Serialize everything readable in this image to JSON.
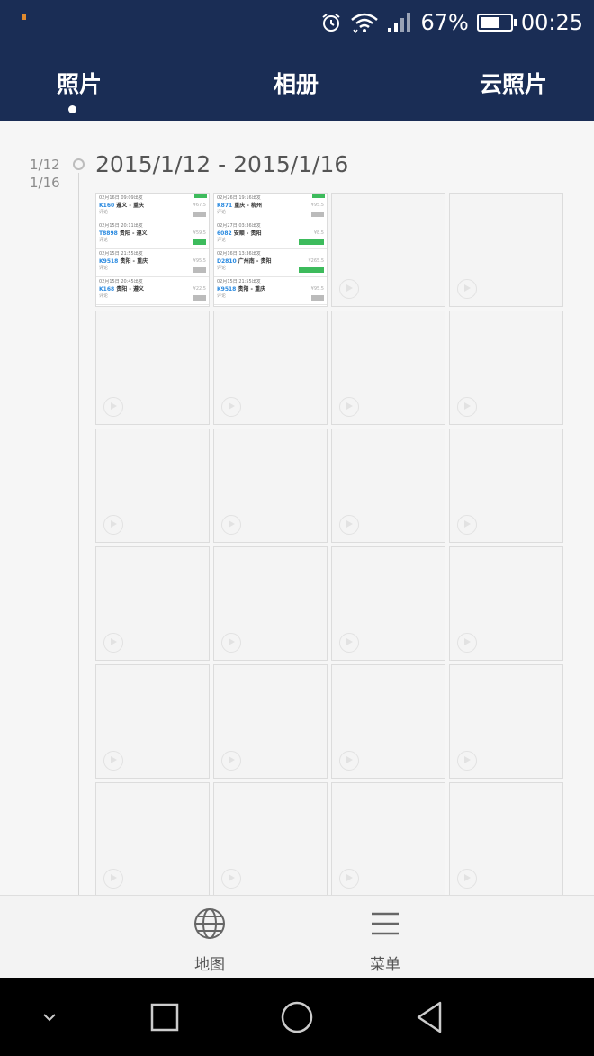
{
  "status_bar": {
    "battery_percent": "67%",
    "time": "00:25",
    "battery_level": 0.67
  },
  "tabs": [
    {
      "label": "照片",
      "selected": true
    },
    {
      "label": "相册",
      "selected": false
    },
    {
      "label": "云照片",
      "selected": false
    }
  ],
  "timeline": {
    "date_short_start": "1/12",
    "date_short_end": "1/16",
    "date_range": "2015/1/12 - 2015/1/16"
  },
  "screenshots": [
    {
      "rows": [
        {
          "time": "02月16日  09:09出发",
          "train": "K160",
          "route": "遵义 - 重庆",
          "note": "评论",
          "price": "¥67.5",
          "tag": "gray"
        },
        {
          "time": "02月15日  20:11出发",
          "train": "T8898",
          "route": "贵阳 - 遵义",
          "note": "评论",
          "price": "¥59.5",
          "tag": "green"
        },
        {
          "time": "02月15日  21:55出发",
          "train": "K9518",
          "route": "贵阳 - 重庆",
          "note": "评论",
          "price": "¥95.5",
          "tag": "gray"
        },
        {
          "time": "02月15日  20:45出发",
          "train": "K168",
          "route": "贵阳 - 遵义",
          "note": "评论",
          "price": "¥22.5",
          "tag": "gray"
        }
      ]
    },
    {
      "rows": [
        {
          "time": "02月26日  19:16出发",
          "train": "K871",
          "route": "重庆 - 柳州",
          "note": "评论",
          "price": "¥95.5",
          "tag": "gray"
        },
        {
          "time": "02月27日  03:36出发",
          "train": "6082",
          "route": "安顺 - 贵阳",
          "note": "评论",
          "price": "¥8.5",
          "tag": "green-wide"
        },
        {
          "time": "02月16日  13:36出发",
          "train": "D2810",
          "route": "广州南 - 贵阳",
          "note": "评论",
          "price": "¥265.5",
          "tag": "green-wide"
        },
        {
          "time": "02月15日  21:55出发",
          "train": "K9518",
          "route": "贵阳 - 重庆",
          "note": "评论",
          "price": "¥95.5",
          "tag": "gray"
        }
      ]
    }
  ],
  "grid": {
    "total_tiles": 24
  },
  "bottom_actions": {
    "map_label": "地图",
    "menu_label": "菜单"
  },
  "colors": {
    "header_bg": "#1a2d55",
    "accent_green": "#3dbb5c",
    "train_blue": "#2a8ae0"
  }
}
